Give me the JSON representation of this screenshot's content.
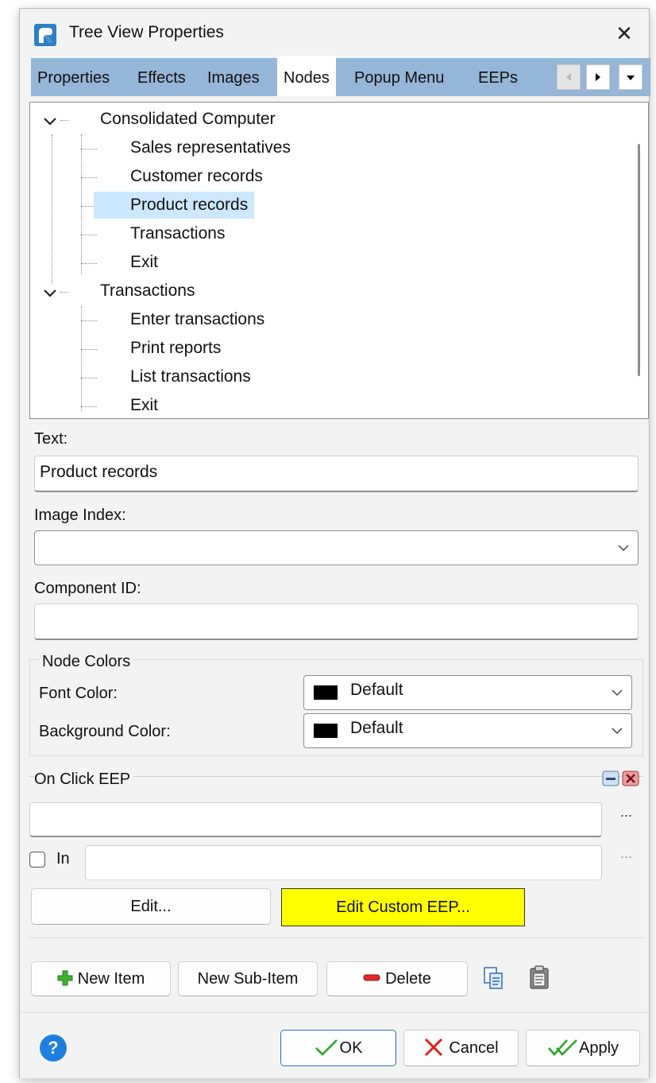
{
  "window": {
    "title": "Tree View Properties",
    "close_glyph": "✕"
  },
  "tabs": [
    {
      "label": "Properties",
      "active": false
    },
    {
      "label": "Effects",
      "active": false
    },
    {
      "label": "Images",
      "active": false
    },
    {
      "label": "Nodes",
      "active": true
    },
    {
      "label": "Popup Menu",
      "active": false
    },
    {
      "label": "EEPs",
      "active": false
    }
  ],
  "tree": {
    "nodes": [
      {
        "label": "Consolidated Computer",
        "level": 0,
        "expanded": true
      },
      {
        "label": "Sales representatives",
        "level": 1
      },
      {
        "label": "Customer records",
        "level": 1
      },
      {
        "label": "Product records",
        "level": 1,
        "selected": true
      },
      {
        "label": "Transactions",
        "level": 1
      },
      {
        "label": "Exit",
        "level": 1
      },
      {
        "label": "Transactions",
        "level": 0,
        "expanded": true
      },
      {
        "label": "Enter transactions",
        "level": 1
      },
      {
        "label": "Print reports",
        "level": 1
      },
      {
        "label": "List transactions",
        "level": 1
      },
      {
        "label": "Exit",
        "level": 1
      }
    ]
  },
  "fields": {
    "text_label": "Text:",
    "text_value": "Product records",
    "image_index_label": "Image Index:",
    "image_index_value": "",
    "component_id_label": "Component ID:",
    "component_id_value": ""
  },
  "node_colors": {
    "legend": "Node Colors",
    "font_color_label": "Font Color:",
    "font_color_value": "Default",
    "background_color_label": "Background Color:",
    "background_color_value": "Default",
    "swatch_color": "#000000"
  },
  "on_click": {
    "legend": "On Click EEP",
    "ellipsis": "...",
    "in_label": "In",
    "in_checked": false,
    "edit_label": "Edit...",
    "edit_custom_label": "Edit Custom EEP...",
    "edit_custom_color": "#ffff00"
  },
  "item_buttons": {
    "new_item": "New Item",
    "new_sub_item": "New Sub-Item",
    "delete": "Delete"
  },
  "footer": {
    "help_glyph": "?",
    "ok": "OK",
    "cancel": "Cancel",
    "apply": "Apply"
  },
  "colors": {
    "tab_bar": "#95b6d6",
    "selection": "#cce8ff",
    "help_blue": "#1f7fe0",
    "ok_check": "#2aa52a",
    "cancel_x": "#e0201a"
  }
}
